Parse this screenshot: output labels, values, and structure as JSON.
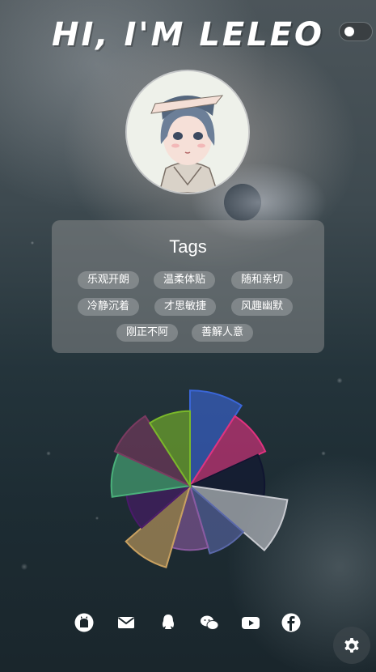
{
  "header": {
    "title": "HI, I'M LELEO"
  },
  "theme_toggle": {
    "state": "off"
  },
  "avatar": {
    "icon": "anime-girl-avatar"
  },
  "tags": {
    "title": "Tags",
    "items": [
      "乐观开朗",
      "温柔体贴",
      "随和亲切",
      "冷静沉着",
      "才思敏捷",
      "风趣幽默",
      "刚正不阿",
      "善解人意"
    ]
  },
  "rose_chart": {
    "type": "nightingale-rose",
    "slices": [
      {
        "color": "#3a66d8",
        "value": 0.92
      },
      {
        "color": "#e0327f",
        "value": 0.8
      },
      {
        "color": "#101530",
        "value": 0.72
      },
      {
        "color": "#c8cad0",
        "value": 0.95
      },
      {
        "color": "#5a68a8",
        "value": 0.68
      },
      {
        "color": "#8a5aa0",
        "value": 0.62
      },
      {
        "color": "#c8a060",
        "value": 0.82
      },
      {
        "color": "#4a1a6a",
        "value": 0.62
      },
      {
        "color": "#4ab07a",
        "value": 0.76
      },
      {
        "color": "#7a3a60",
        "value": 0.8
      },
      {
        "color": "#7ab82a",
        "value": 0.72
      }
    ]
  },
  "social": [
    {
      "icon": "github-icon"
    },
    {
      "icon": "mail-icon"
    },
    {
      "icon": "qq-icon"
    },
    {
      "icon": "wechat-icon"
    },
    {
      "icon": "youtube-icon"
    },
    {
      "icon": "facebook-icon"
    }
  ],
  "settings": {
    "icon": "gear-icon"
  }
}
